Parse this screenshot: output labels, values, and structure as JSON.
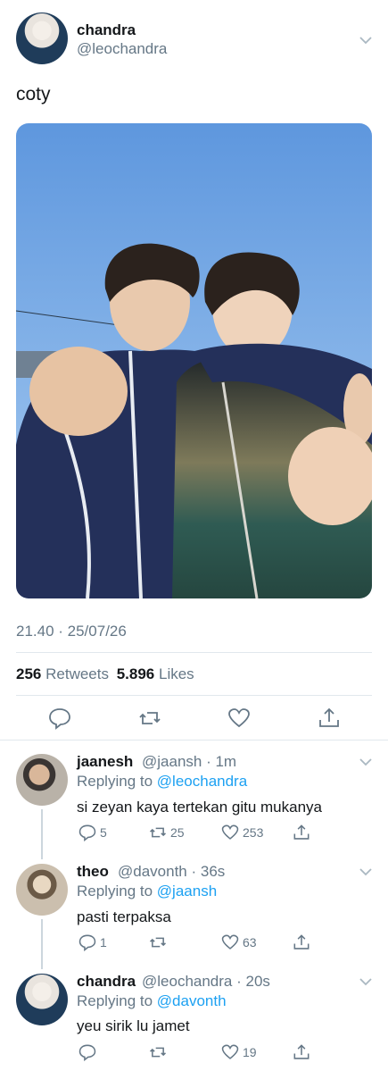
{
  "colors": {
    "accent": "#1da1f2",
    "secondary_text": "#657786",
    "divider": "#e1e8ed"
  },
  "main_tweet": {
    "name": "chandra",
    "handle": "@leochandra",
    "text": "coty",
    "timestamp": "21.40 · 25/07/26",
    "retweets_count": "256",
    "retweets_label": "Retweets",
    "likes_count": "5.896",
    "likes_label": "Likes",
    "actions": [
      "reply-icon",
      "retweet-icon",
      "like-icon",
      "share-icon"
    ]
  },
  "replies": [
    {
      "name": "jaanesh",
      "handle": "@jaansh · 1m",
      "replying_prefix": "Replying to",
      "replying_to": "@leochandra",
      "text": "si zeyan kaya tertekan gitu mukanya",
      "reply_count": "5",
      "retweet_count": "25",
      "like_count": "253"
    },
    {
      "name": "theo",
      "handle": "@davonth · 36s",
      "replying_prefix": "Replying to",
      "replying_to": "@jaansh",
      "text": "pasti terpaksa",
      "reply_count": "1",
      "retweet_count": "",
      "like_count": "63"
    },
    {
      "name": "chandra",
      "handle": "@leochandra · 20s",
      "replying_prefix": "Replying to",
      "replying_to": "@davonth",
      "text": "yeu sirik lu jamet",
      "reply_count": "",
      "retweet_count": "",
      "like_count": "19"
    }
  ]
}
